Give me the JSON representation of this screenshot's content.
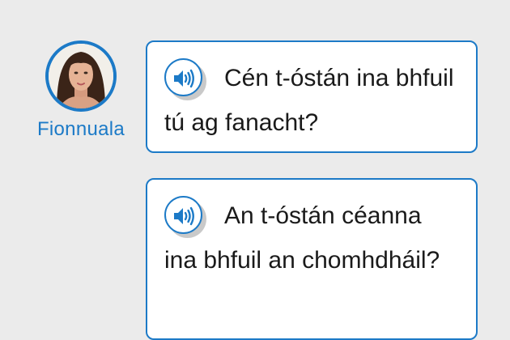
{
  "speaker": {
    "name": "Fionnuala",
    "avatar_icon": "portrait-avatar"
  },
  "messages": [
    {
      "text": "Cén t-óstán ina bhfuil tú ag fanacht?",
      "audio_icon": "speaker-icon"
    },
    {
      "text": "An t-óstán céanna ina bhfuil an chomhdháil?",
      "audio_icon": "speaker-icon"
    }
  ],
  "colors": {
    "accent": "#1c7ac7",
    "background": "#ebebeb",
    "bubble": "#ffffff",
    "text": "#1a1a1a"
  }
}
